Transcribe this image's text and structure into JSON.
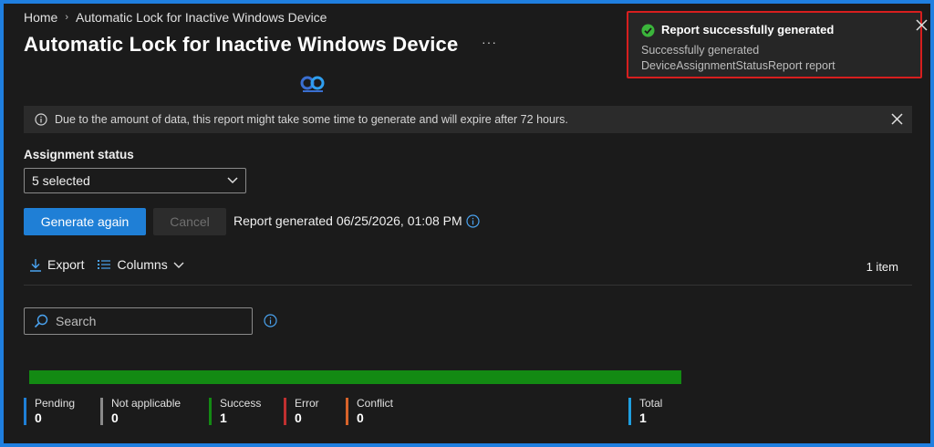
{
  "breadcrumb": {
    "home": "Home",
    "current": "Automatic Lock for Inactive Windows Device"
  },
  "page": {
    "title": "Automatic Lock for Inactive Windows Device",
    "more": "···"
  },
  "info_bar": {
    "text": "Due to the amount of data, this report might take some time to generate and will expire after 72 hours."
  },
  "filter": {
    "label": "Assignment status",
    "selected": "5 selected"
  },
  "actions": {
    "generate_label": "Generate again",
    "cancel_label": "Cancel",
    "generated_text": "Report generated 06/25/2026, 01:08 PM"
  },
  "toolbar": {
    "export_label": "Export",
    "columns_label": "Columns",
    "item_count": "1 item"
  },
  "search": {
    "placeholder": "Search"
  },
  "progress": {
    "success_fraction": 1.0,
    "color": "#138a13"
  },
  "stats": [
    {
      "label": "Pending",
      "value": "0",
      "color": "#1f7fd6"
    },
    {
      "label": "Not applicable",
      "value": "0",
      "color": "#8a8a8a"
    },
    {
      "label": "Success",
      "value": "1",
      "color": "#138a13"
    },
    {
      "label": "Error",
      "value": "0",
      "color": "#c03030"
    },
    {
      "label": "Conflict",
      "value": "0",
      "color": "#d8632a"
    },
    {
      "label": "Total",
      "value": "1",
      "color": "#1f9fe0"
    }
  ],
  "toast": {
    "title": "Report successfully generated",
    "body": "Successfully generated DeviceAssignmentStatusReport report"
  },
  "colors": {
    "accent": "#1f7fd6",
    "toast_border": "#d71e1e",
    "success": "#138a13"
  }
}
